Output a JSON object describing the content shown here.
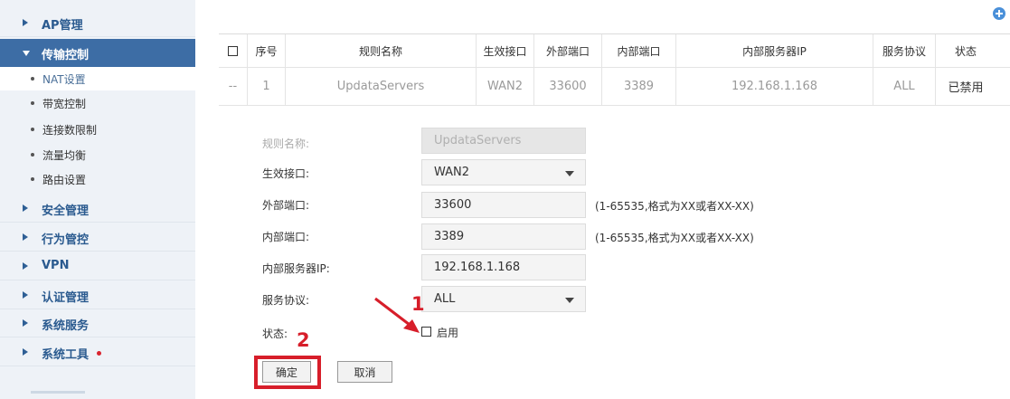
{
  "sidebar": {
    "items": [
      {
        "label": "AP管理"
      },
      {
        "label": "传输控制"
      },
      {
        "label": "安全管理"
      },
      {
        "label": "行为管控"
      },
      {
        "label": "VPN"
      },
      {
        "label": "认证管理"
      },
      {
        "label": "系统服务"
      },
      {
        "label": "系统工具"
      }
    ],
    "subitems": [
      {
        "label": "NAT设置"
      },
      {
        "label": "带宽控制"
      },
      {
        "label": "连接数限制"
      },
      {
        "label": "流量均衡"
      },
      {
        "label": "路由设置"
      }
    ]
  },
  "table": {
    "headers": [
      "序号",
      "规则名称",
      "生效接口",
      "外部端口",
      "内部端口",
      "内部服务器IP",
      "服务协议",
      "状态"
    ],
    "row": {
      "select": "--",
      "index": "1",
      "name": "UpdataServers",
      "interface": "WAN2",
      "ext_port": "33600",
      "int_port": "3389",
      "server_ip": "192.168.1.168",
      "protocol": "ALL",
      "status": "已禁用"
    }
  },
  "form": {
    "name_label": "规则名称:",
    "name_value": "UpdataServers",
    "interface_label": "生效接口:",
    "interface_value": "WAN2",
    "ext_port_label": "外部端口:",
    "ext_port_value": "33600",
    "ext_port_hint": "(1-65535,格式为XX或者XX-XX)",
    "int_port_label": "内部端口:",
    "int_port_value": "3389",
    "int_port_hint": "(1-65535,格式为XX或者XX-XX)",
    "server_ip_label": "内部服务器IP:",
    "server_ip_value": "192.168.1.168",
    "protocol_label": "服务协议:",
    "protocol_value": "ALL",
    "status_label": "状态:",
    "enable_label": "启用",
    "enable_checked": false,
    "confirm_label": "确定",
    "cancel_label": "取消"
  },
  "annotations": {
    "step1": "1",
    "step2": "2",
    "color": "#d71e2a"
  },
  "colors": {
    "sidebar_bg": "#eef2f7",
    "active_nav": "#3d6da5",
    "nav_text": "#2a5a8f"
  }
}
